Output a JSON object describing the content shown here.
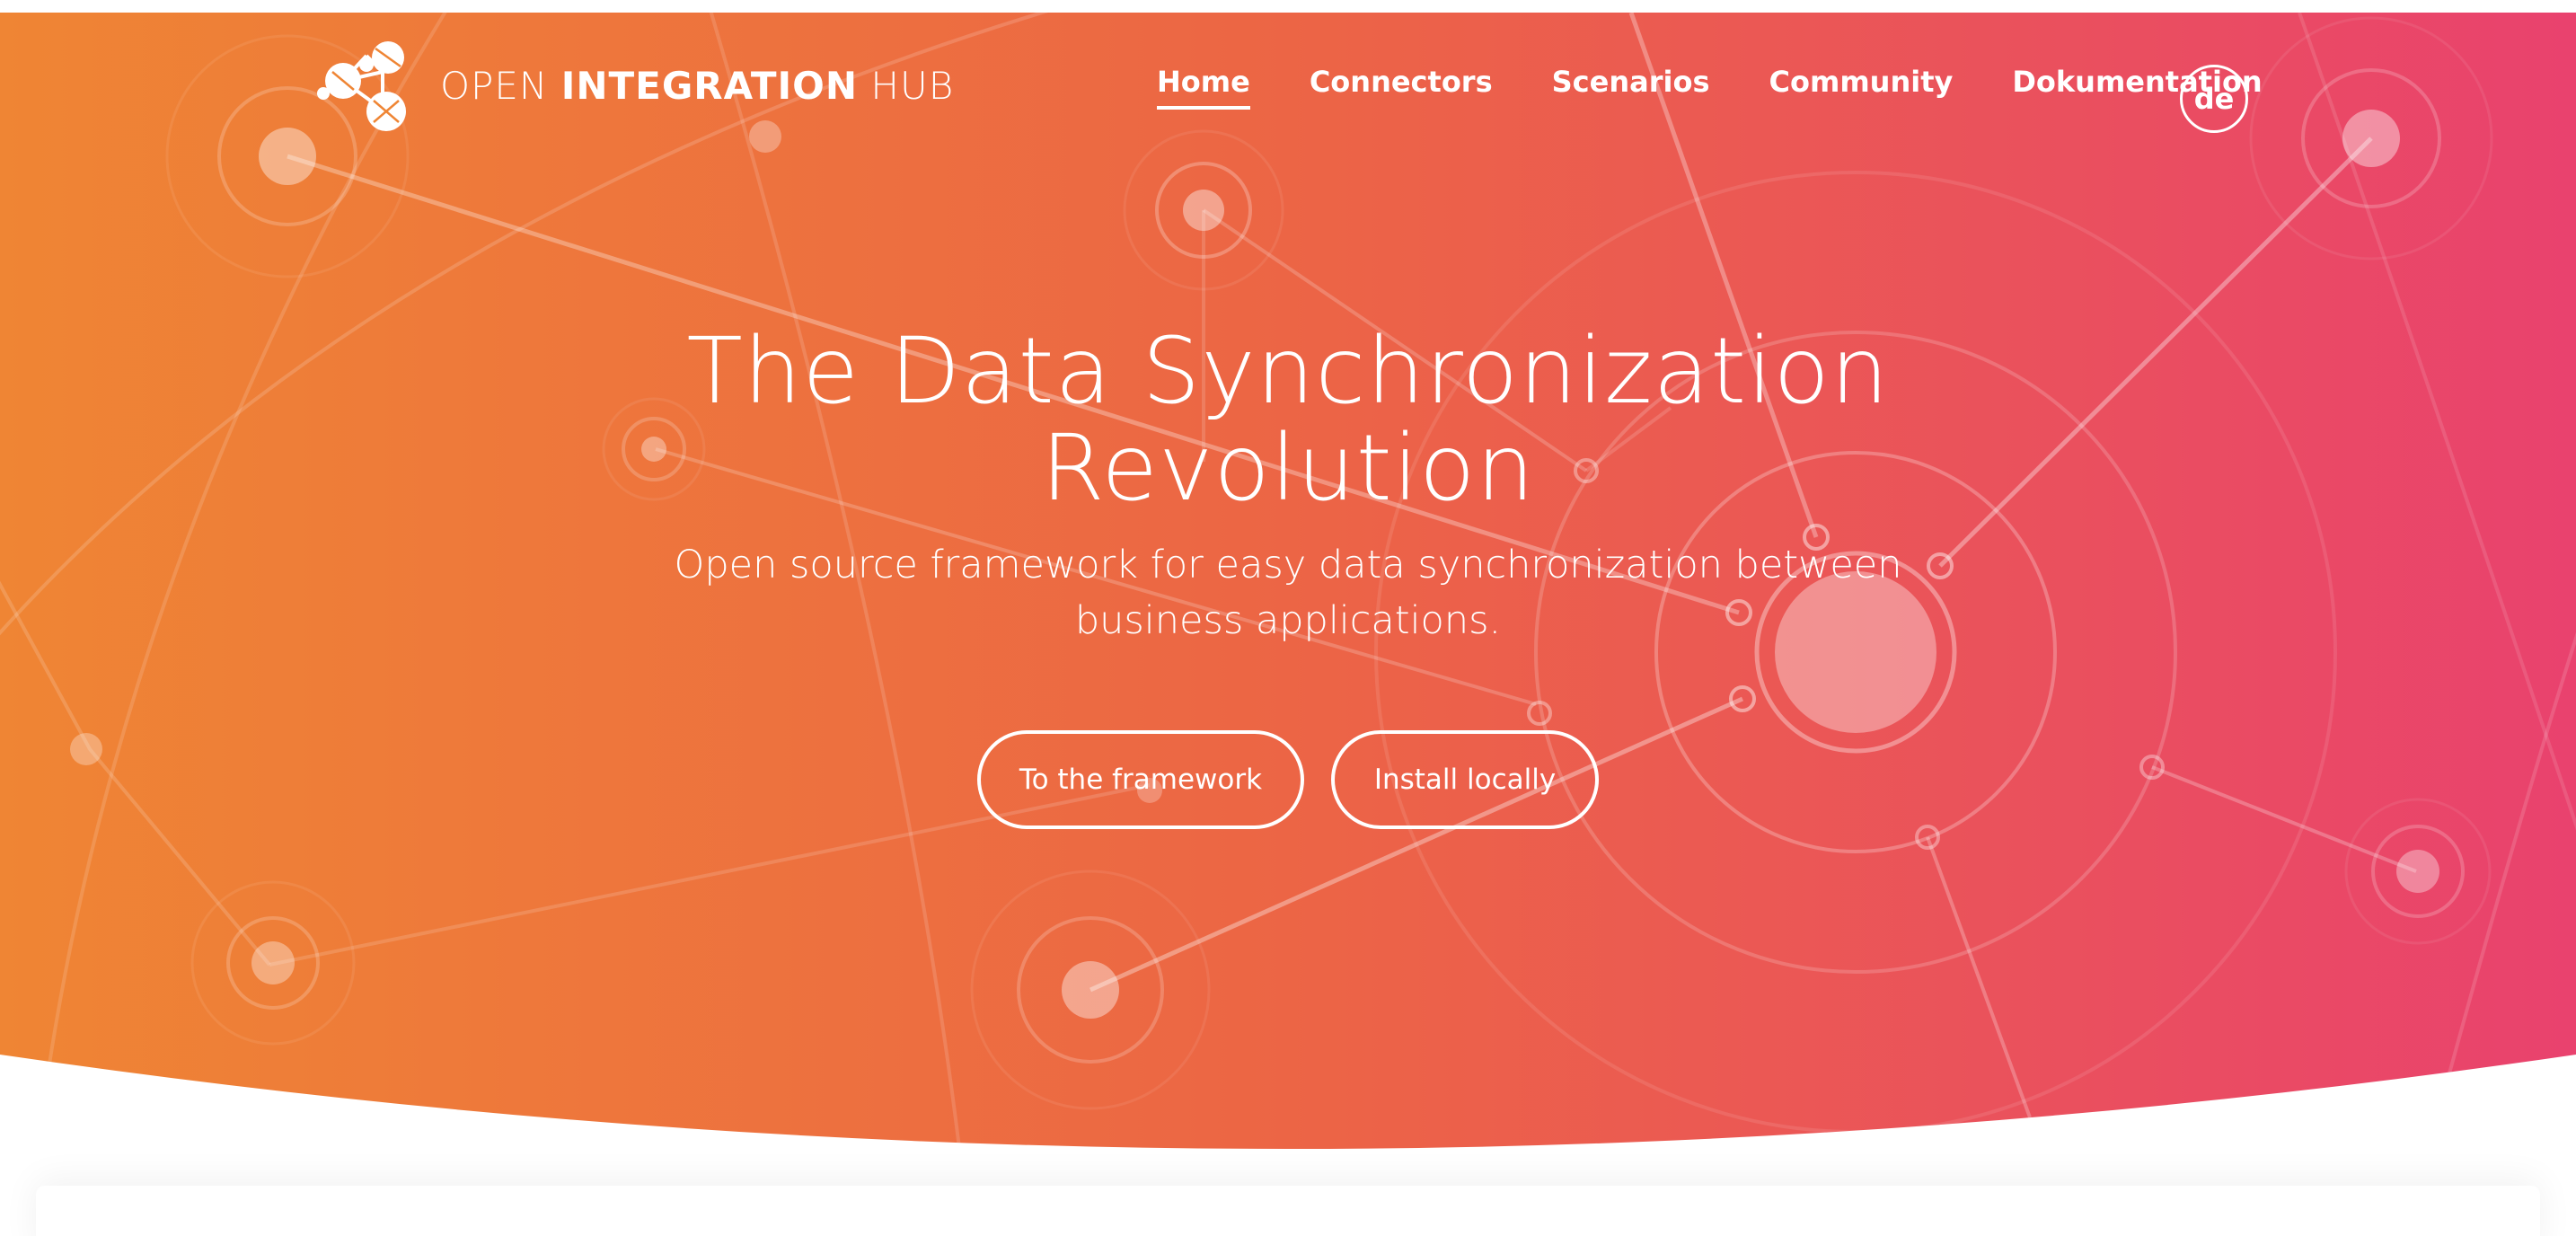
{
  "brand": {
    "word1": "OPEN ",
    "word2": "INTEGRATION",
    "word3": " HUB",
    "logo_icon": "network-molecule-icon"
  },
  "nav": {
    "items": [
      {
        "label": "Home",
        "active": true
      },
      {
        "label": "Connectors",
        "active": false
      },
      {
        "label": "Scenarios",
        "active": false
      },
      {
        "label": "Community",
        "active": false
      },
      {
        "label": "Dokumentation",
        "active": false
      }
    ],
    "language": "de"
  },
  "hero": {
    "title": "The Data Synchronization Revolution",
    "subtitle": "Open source framework for easy data synchronization between business applications.",
    "buttons": {
      "framework": "To the framework",
      "install": "Install locally"
    }
  },
  "colors": {
    "gradient_start": "#EF8534",
    "gradient_mid": "#EC6545",
    "gradient_end": "#E9426E",
    "text": "#FFFFFF"
  }
}
